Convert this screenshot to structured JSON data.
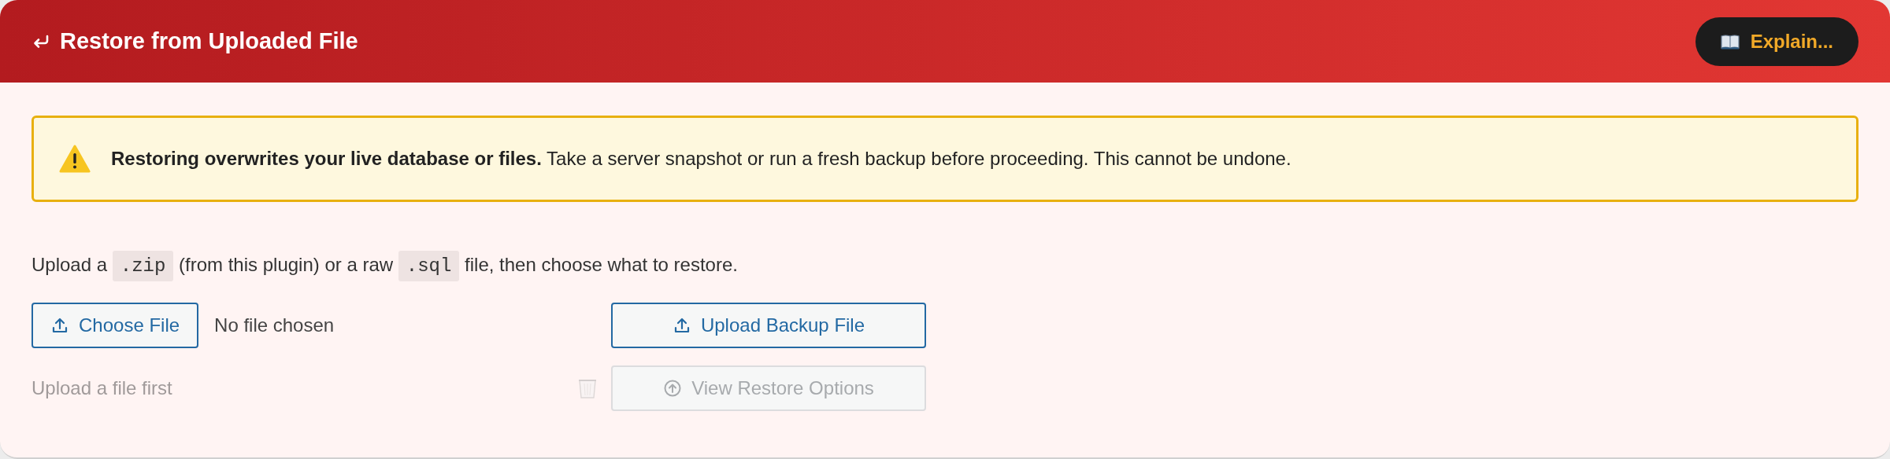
{
  "header": {
    "title": "Restore from Uploaded File",
    "explain_button": "Explain..."
  },
  "warning": {
    "text": "**Restoring overwrites your live database or files.** Take a server snapshot or run a fresh backup before proceeding. This cannot be undone."
  },
  "instructions": [
    {
      "kind": "text",
      "text": "Upload a"
    },
    {
      "kind": "code",
      "text": ".zip"
    },
    {
      "kind": "text",
      "text": "(from this plugin) or a raw"
    },
    {
      "kind": "code",
      "text": ".sql"
    },
    {
      "kind": "text",
      "text": "file, then choose what to restore."
    }
  ],
  "file_input": {
    "button": "Choose File",
    "status": "No file chosen"
  },
  "upload_button": {
    "label": "Upload Backup File",
    "disabled": false
  },
  "file_hint": "Upload a file first",
  "delete_button": {
    "disabled": true
  },
  "restore_button": {
    "label": "View Restore Options",
    "disabled": true
  }
}
